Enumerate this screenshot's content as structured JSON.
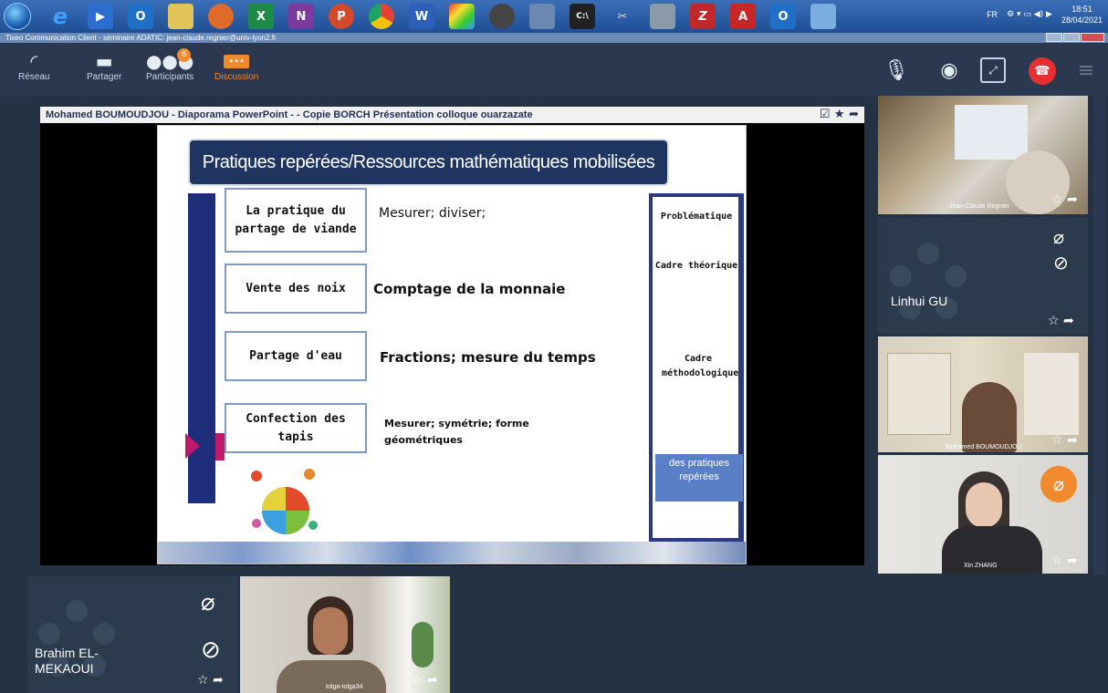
{
  "taskbar": {
    "icons": [
      "firefox",
      "ie-icon",
      "media-player",
      "outlook",
      "file-explorer",
      "firefox",
      "excel",
      "onenote",
      "powerpoint",
      "chrome",
      "word",
      "paint",
      "winamp",
      "settings",
      "terminal",
      "tool",
      "calculator",
      "filezilla",
      "acrobat",
      "outlook",
      "tixeo"
    ],
    "tray": {
      "lang": "FR",
      "time": "18:51",
      "date": "28/04/2021"
    }
  },
  "window": {
    "title": "Tixeo Communication Client - séminaire ADATIC: jean-claude.regnier@univ-lyon2.fr"
  },
  "toolbar": {
    "network_label": "Réseau",
    "share_label": "Partager",
    "participants_label": "Participants",
    "participants_count": "6",
    "discussion_label": "Discussion"
  },
  "share": {
    "title": "Mohamed BOUMOUDJOU - Diaporama PowerPoint -  - Copie BORCH Présentation colloque ouarzazate"
  },
  "slide": {
    "heading": "Pratiques repérées/Ressources mathématiques mobilisées",
    "practices": [
      {
        "box": "La pratique du partage de viande",
        "resources": "Mesurer; diviser;"
      },
      {
        "box": "Vente des noix",
        "resources": "Comptage de la monnaie"
      },
      {
        "box": "Partage d'eau",
        "resources": "Fractions; mesure du temps"
      },
      {
        "box": "Confection des tapis",
        "resources": "Mesurer; symétrie; forme géométriques"
      }
    ],
    "panel": {
      "items": [
        "Problématique",
        "Cadre théorique",
        "Cadre méthodologique"
      ],
      "active": "des pratiques repérées"
    }
  },
  "participants": {
    "jean_claude": "Jean-Claude Regnier",
    "linhui": "Linhui GU",
    "mohamed": "Mohamed BOUMOUDJOU",
    "xin": "Xin  ZHANG",
    "brahim": "Brahim  EL-MEKAOUI",
    "tolga": "tolga-tolga34"
  },
  "colors": {
    "accent": "#f08a2c",
    "slide_navy": "#1f3560",
    "hangup": "#e5302f"
  }
}
